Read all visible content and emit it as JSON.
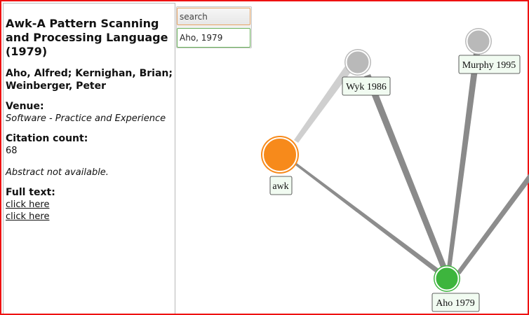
{
  "paper": {
    "title": "Awk-A Pattern Scanning and Processing Language (1979)",
    "authors": "Aho, Alfred; Kernighan, Brian; Weinberger, Peter",
    "venue_label": "Venue:",
    "venue": "Software - Practice and Experience",
    "citation_label": "Citation count:",
    "citation_count": "68",
    "abstract": "Abstract not available.",
    "fulltext_label": "Full text:",
    "links": [
      "click here",
      "click here"
    ]
  },
  "search": {
    "placeholder": "search",
    "result": "Aho, 1979"
  },
  "graph": {
    "nodes": [
      {
        "id": "awk",
        "label": "awk",
        "color": "#f78a1b"
      },
      {
        "id": "wyk",
        "label": "Wyk 1986",
        "color": "#b9b9b9"
      },
      {
        "id": "murphy",
        "label": "Murphy 1995",
        "color": "#b9b9b9"
      },
      {
        "id": "aho",
        "label": "Aho 1979",
        "color": "#3db53d"
      }
    ],
    "edges": [
      {
        "from": "awk",
        "to": "wyk",
        "weight": 1
      },
      {
        "from": "awk",
        "to": "aho",
        "weight": 2
      },
      {
        "from": "wyk",
        "to": "aho",
        "weight": 3
      },
      {
        "from": "murphy",
        "to": "aho",
        "weight": 3
      },
      {
        "from": "aho",
        "to": "offscreen",
        "weight": 2
      }
    ]
  }
}
